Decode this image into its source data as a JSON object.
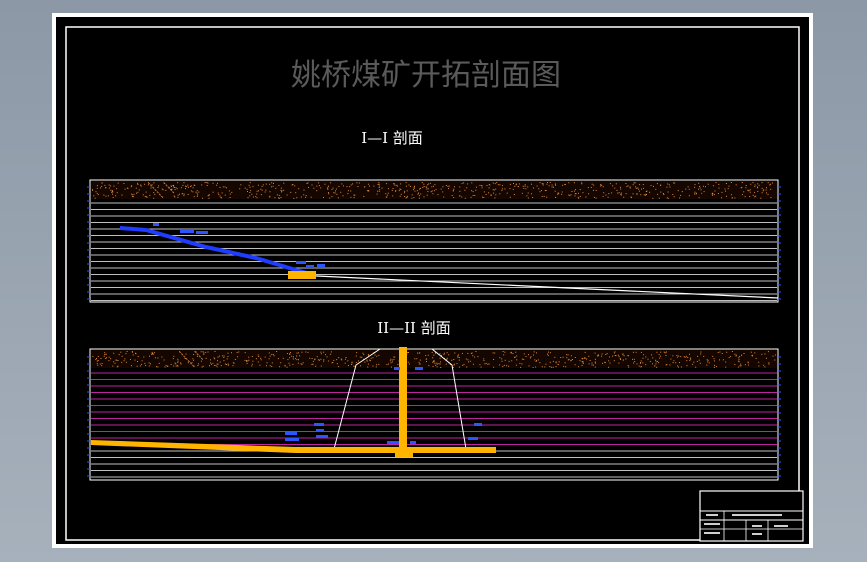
{
  "drawing": {
    "title": "姚桥煤矿开拓剖面图",
    "section1_title": "I—I 剖面",
    "section2_title": "II—II 剖面"
  },
  "colors": {
    "canvas": "#000000",
    "frame": "#ffffff",
    "title_gray": "#5a5a5a",
    "topsoil": "#e0883a",
    "strata_lines": "#ffffff",
    "strata_magenta": "#ff2fd6",
    "roadway_blue": "#1f3cff",
    "shaft_orange": "#ffb400",
    "label_blue": "#2c55ff"
  },
  "icons": {
    "section1": "inclined-roadway-symbol",
    "section2": "vertical-shaft-symbol"
  }
}
